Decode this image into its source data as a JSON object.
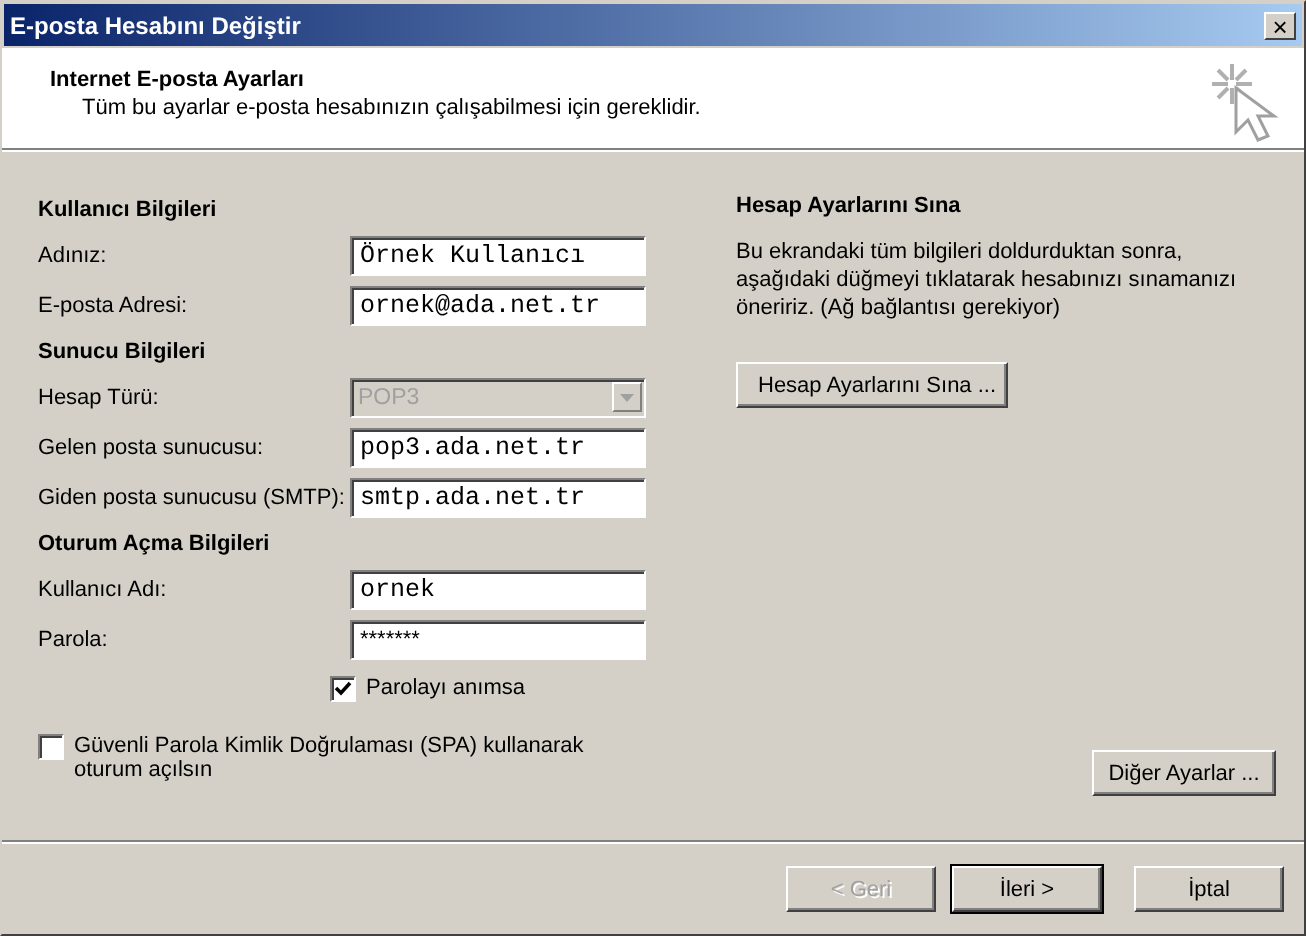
{
  "window": {
    "title": "E-posta Hesabını Değiştir",
    "close": "×"
  },
  "header": {
    "title": "Internet E-posta Ayarları",
    "subtitle": "Tüm bu ayarlar e-posta hesabınızın çalışabilmesi için gereklidir."
  },
  "sections": [
    {
      "title": "Kullanıcı Bilgileri",
      "fields": [
        {
          "kind": "text",
          "label": "Adınız:",
          "value": "Örnek Kullanıcı",
          "disabled": false
        },
        {
          "kind": "text",
          "label": "E-posta Adresi:",
          "value": "ornek@ada.net.tr",
          "disabled": false
        }
      ]
    },
    {
      "title": "Sunucu Bilgileri",
      "fields": [
        {
          "kind": "select",
          "label": "Hesap Türü:",
          "value": "POP3",
          "disabled": true
        },
        {
          "kind": "text",
          "label": "Gelen posta sunucusu:",
          "value": "pop3.ada.net.tr",
          "disabled": false
        },
        {
          "kind": "text",
          "label": "Giden posta sunucusu (SMTP):",
          "value": "smtp.ada.net.tr",
          "disabled": false
        }
      ]
    },
    {
      "title": "Oturum Açma Bilgileri",
      "fields": [
        {
          "kind": "text",
          "label": "Kullanıcı Adı:",
          "value": "ornek",
          "disabled": false
        },
        {
          "kind": "password",
          "label": "Parola:",
          "value": "*******",
          "disabled": false
        }
      ]
    }
  ],
  "remember_password": {
    "label": "Parolayı anımsa",
    "checked": true
  },
  "spa": {
    "label": "Güvenli Parola Kimlik Doğrulaması (SPA) kullanarak oturum açılsın",
    "checked": false
  },
  "test": {
    "title": "Hesap Ayarlarını Sına",
    "text": "Bu ekrandaki tüm bilgileri doldurduktan sonra, aşağıdaki düğmeyi tıklatarak hesabınızı sınamanızı öneririz. (Ağ bağlantısı gerekiyor)",
    "button": "Hesap Ayarlarını Sına ..."
  },
  "more_button": "Diğer Ayarlar ...",
  "buttons": [
    {
      "label": "< Geri",
      "disabled": true,
      "default": false
    },
    {
      "label": "İleri >",
      "disabled": false,
      "default": true
    },
    {
      "label": "İptal",
      "disabled": false,
      "default": false
    }
  ]
}
